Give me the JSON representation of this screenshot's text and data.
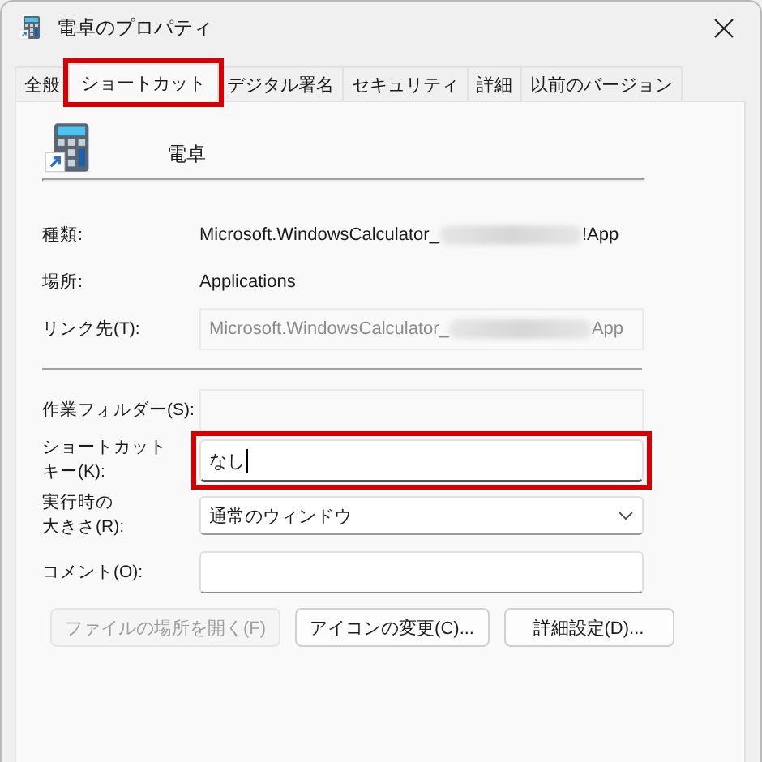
{
  "window": {
    "title": "電卓のプロパティ"
  },
  "tabs": [
    {
      "label": "全般",
      "selected": false,
      "highlighted": false
    },
    {
      "label": "ショートカット",
      "selected": true,
      "highlighted": true
    },
    {
      "label": "デジタル署名",
      "selected": false,
      "highlighted": false
    },
    {
      "label": "セキュリティ",
      "selected": false,
      "highlighted": false
    },
    {
      "label": "詳細",
      "selected": false,
      "highlighted": false
    },
    {
      "label": "以前のバージョン",
      "selected": false,
      "highlighted": false
    }
  ],
  "app": {
    "name": "電卓"
  },
  "fields": [
    {
      "kind": "text",
      "label": "種類:",
      "value": "Microsoft.WindowsCalculator_",
      "redacted": true,
      "value_end": "!App"
    },
    {
      "kind": "text",
      "label": "場所:",
      "value": "Applications",
      "redacted": false
    },
    {
      "kind": "readonly",
      "label": "リンク先(T):",
      "value": "Microsoft.WindowsCalculator_",
      "redacted": true,
      "value_end": "App"
    },
    {
      "kind": "divider"
    },
    {
      "kind": "readonly",
      "label": "作業フォルダー(S):"
    },
    {
      "kind": "input",
      "label": [
        "ショートカット",
        "キー(K):"
      ],
      "value": "なし",
      "focused": true,
      "highlighted": true
    },
    {
      "kind": "dropdown",
      "label": [
        "実行時の",
        "大きさ(R):"
      ],
      "value": "通常のウィンドウ"
    },
    {
      "kind": "input",
      "label": "コメント(O):",
      "focused": false,
      "highlighted": false
    }
  ],
  "buttons": [
    {
      "label": "ファイルの場所を開く(F)",
      "disabled": true
    },
    {
      "label": "アイコンの変更(C)...",
      "disabled": false
    },
    {
      "label": "詳細設定(D)...",
      "disabled": false
    }
  ]
}
